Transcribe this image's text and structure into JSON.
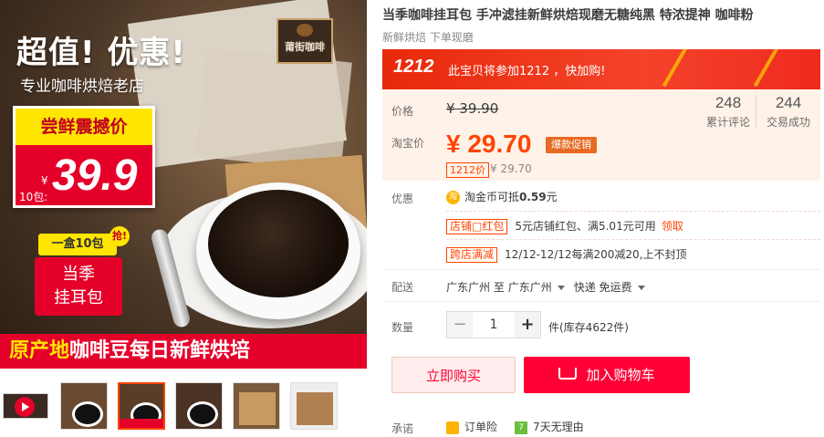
{
  "product": {
    "title": "当季咖啡挂耳包 手冲滤挂新鲜烘焙现磨无糖纯黑 特浓提神 咖啡粉",
    "subtitle": "新鲜烘焙 下单现磨"
  },
  "main_image": {
    "headline": "超值! 优惠!",
    "subline": "专业咖啡烘焙老店",
    "logo_text": "莆街咖啡",
    "promo_label": "尝鲜震撼价",
    "promo_currency": "¥",
    "promo_price": "39.9",
    "promo_unit": "10包:",
    "pack_tag": "一盒10包",
    "pack_grab": "抢!",
    "pack_line1": "当季",
    "pack_line2": "挂耳包",
    "banner_highlight": "原产地",
    "banner_rest": "咖啡豆每日新鲜烘培"
  },
  "thumbnails": [
    "video",
    "img-1",
    "img-2",
    "img-3",
    "img-4",
    "img-5"
  ],
  "event": {
    "badge": "1212",
    "text": "此宝贝将参加1212 ，快加购!"
  },
  "price": {
    "label_price": "价格",
    "original": "¥ 39.90",
    "label_taobao": "淘宝价",
    "current": "¥ 29.70",
    "hot_tag": "爆款促销",
    "event_tag": "1212价",
    "event_price": "¥ 29.70"
  },
  "stats": {
    "reviews_count": "248",
    "reviews_label": "累计评论",
    "sales_count": "244",
    "sales_label": "交易成功"
  },
  "promotions": {
    "label": "优惠",
    "coin_icon": "淘",
    "coin_text": "淘金币可抵",
    "coin_value": "0.59",
    "coin_unit": "元",
    "shop_tag": "店铺□红包",
    "shop_text": "5元店铺红包、满5.01元可用",
    "shop_link": "领取",
    "cross_tag": "跨店满减",
    "cross_text": "12/12-12/12每满200减20,上不封顶"
  },
  "delivery": {
    "label": "配送",
    "from": "广东广州",
    "to_word": "至",
    "to": "广东广州",
    "method": "快递 免运费"
  },
  "quantity": {
    "label": "数量",
    "minus": "−",
    "value": "1",
    "plus": "+",
    "stock": "件(库存4622件)"
  },
  "actions": {
    "buy_now": "立即购买",
    "add_cart": "加入购物车"
  },
  "promise": {
    "label": "承诺",
    "item1": "订单险",
    "item2": "7天无理由",
    "item2_icon": "7"
  },
  "colors": {
    "accent": "#ff4400",
    "cart_red": "#ff0036",
    "panel_bg": "#fff2e8"
  }
}
